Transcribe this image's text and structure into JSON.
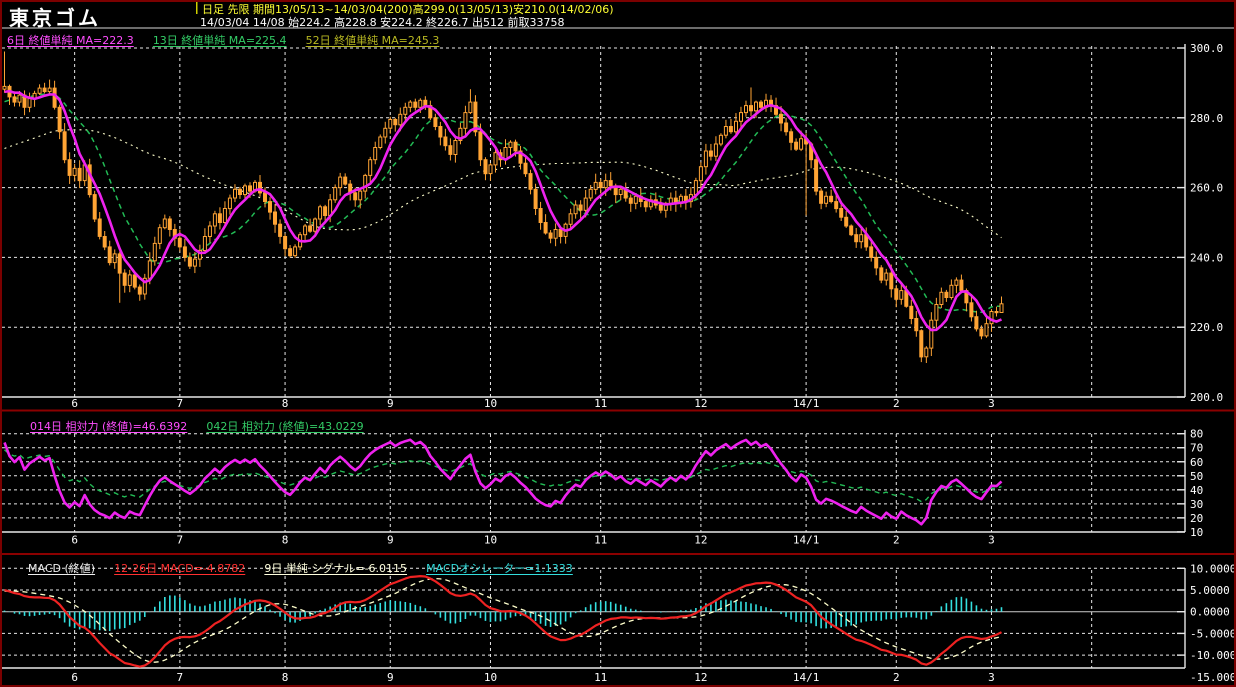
{
  "header": {
    "title": "東京ゴム",
    "info_line1": "日足 先限 期間13/05/13~14/03/04(200)高299.0(13/05/13)安210.0(14/02/06)",
    "info_line2": "14/03/04 14/08 始224.2 高228.8 安224.2 終226.7 出512 前取33758"
  },
  "main_legend": {
    "ma6": "6日 終値単純 MA=222.3",
    "ma13": "13日 終値単純 MA=225.4",
    "ma52": "52日 終値単純 MA=245.3"
  },
  "rsi_legend": {
    "rsi14": "014日 相対力 (終値)=46.6392",
    "rsi42": "042日 相対力 (終値)=43.0229"
  },
  "macd_legend": {
    "title": "MACD (終値)",
    "macd": "12-26日 MACD=-4.8782",
    "signal": "9日 単純 シグナル=-6.0115",
    "osc": "MACDオシレーター=1.1333"
  },
  "colors": {
    "background": "#000000",
    "frame": "#7b0000",
    "grid": "#e8e8e8",
    "candle": "#ffa435",
    "ma6": "#ee22ee",
    "ma13": "#22bb55",
    "ma52": "#ffffcc",
    "rsi14": "#ee22ee",
    "rsi42": "#22bb55",
    "macd_line": "#ee2222",
    "signal_line": "#ffffcc",
    "histogram": "#33e0e0",
    "axis_text": "#ffffff",
    "header_accent": "#cfcf00"
  },
  "chart_data": [
    {
      "type": "candlestick",
      "title": "東京ゴム 日足 先限 13/05/13-14/03/04 (200本)",
      "ylim": [
        200,
        300
      ],
      "yticks": [
        "300.0",
        "280.0",
        "260.0",
        "240.0",
        "220.0",
        "200.0"
      ],
      "ytick_values": [
        300,
        280,
        260,
        240,
        220,
        200
      ],
      "grid": true,
      "legend_position": "top-left",
      "period_high": {
        "value": 299.0,
        "date": "13/05/13"
      },
      "period_low": {
        "value": 210.0,
        "date": "14/02/06"
      },
      "last_bar": {
        "date": "14/03/04",
        "open": 224.2,
        "high": 228.8,
        "low": 224.2,
        "close": 226.7,
        "volume": 512,
        "open_interest": 33758
      },
      "month_ticks": [
        {
          "label": "6",
          "day": 14
        },
        {
          "label": "7",
          "day": 35
        },
        {
          "label": "8",
          "day": 56
        },
        {
          "label": "9",
          "day": 77
        },
        {
          "label": "10",
          "day": 97
        },
        {
          "label": "11",
          "day": 119
        },
        {
          "label": "12",
          "day": 139
        },
        {
          "label": "14/1",
          "day": 160
        },
        {
          "label": "2",
          "day": 178
        },
        {
          "label": "3",
          "day": 197
        },
        {
          "label": "",
          "day": 217
        }
      ],
      "ma_series": [
        {
          "name": "6日 終値単純",
          "period": 6,
          "last_value": 222.3
        },
        {
          "name": "13日 終値単純",
          "period": 13,
          "last_value": 225.4
        },
        {
          "name": "52日 終値単純",
          "period": 52,
          "last_value": 245.3
        }
      ],
      "closes": [
        289,
        286,
        284.5,
        286.5,
        283,
        285.5,
        287,
        288.5,
        287.5,
        288.5,
        283,
        276,
        268,
        263.5,
        265.5,
        262,
        266.5,
        258,
        251,
        246,
        243,
        238.5,
        241,
        235.5,
        232,
        235,
        231.5,
        229.5,
        234,
        239,
        244,
        248.5,
        251,
        248,
        245.5,
        243,
        240,
        237.5,
        239.5,
        242,
        246,
        249,
        252.5,
        250,
        254,
        257,
        259.5,
        258,
        260.5,
        259,
        261.5,
        258.5,
        256,
        253,
        249.5,
        246,
        242.5,
        240.5,
        243,
        246.5,
        249,
        247.5,
        251,
        254.5,
        252,
        256.5,
        260,
        263,
        261,
        258.5,
        256.5,
        259,
        263.5,
        268,
        271.5,
        274.5,
        277,
        279.5,
        278,
        281,
        283,
        284.5,
        283,
        285,
        283.5,
        280,
        277.5,
        274.5,
        272,
        269.5,
        273.5,
        277,
        281.5,
        284.5,
        276,
        268,
        264,
        266.5,
        270,
        268,
        271.5,
        273,
        270.5,
        267,
        264,
        259.5,
        254,
        250,
        247,
        245.5,
        248,
        246,
        249.5,
        252.5,
        255,
        253.5,
        257,
        259.5,
        261.5,
        260,
        262,
        260.5,
        258,
        259.5,
        257,
        255.5,
        257.5,
        256,
        254.5,
        256.5,
        255,
        253.5,
        255.5,
        257,
        255.5,
        257.5,
        256,
        258,
        262,
        266,
        270.5,
        269,
        272.5,
        275,
        277.5,
        276,
        279,
        281.5,
        283.5,
        282,
        284.5,
        283,
        285,
        283.5,
        281,
        278.5,
        276,
        273,
        271,
        274,
        272.5,
        268,
        259,
        255.5,
        257.5,
        256,
        254,
        251.5,
        249,
        246.5,
        244.5,
        246.5,
        243,
        240,
        237,
        233.5,
        235.5,
        231,
        228,
        230.5,
        226,
        222.5,
        219,
        211.5,
        214,
        222,
        226.5,
        230,
        228.5,
        232,
        233.5,
        230.5,
        227,
        223,
        219.5,
        217.5,
        221,
        224.5,
        224.2,
        226.7
      ],
      "wick_overrides": {
        "0": {
          "high": 299.0
        },
        "23": {
          "low": 227.0
        },
        "93": {
          "high": 288.2
        },
        "149": {
          "high": 288.7
        },
        "160": {
          "low": 252.0
        },
        "183": {
          "low": 210.0
        },
        "199": {
          "high": 228.8,
          "low": 224.2
        }
      }
    },
    {
      "type": "line",
      "title": "相対力 (RSI)",
      "ylim": [
        10,
        80
      ],
      "yticks": [
        "80",
        "70",
        "60",
        "50",
        "40",
        "30",
        "20",
        "10"
      ],
      "ytick_values": [
        80,
        70,
        60,
        50,
        40,
        30,
        20,
        10
      ],
      "grid": true,
      "derived_from": "closes",
      "series": [
        {
          "name": "014日 相対力 (終値)",
          "period": 14,
          "last_value": 46.6392,
          "style": "solid"
        },
        {
          "name": "042日 相対力 (終値)",
          "period": 42,
          "last_value": 43.0229,
          "style": "dashed"
        }
      ]
    },
    {
      "type": "macd",
      "title": "MACD (終値)",
      "ylim": [
        -15,
        10
      ],
      "yticks": [
        "10.0000",
        "5.0000",
        "0.0000",
        "-5.0000",
        "-10.0000",
        "-15.0000"
      ],
      "ytick_values": [
        10,
        5,
        0,
        -5,
        -10,
        -15
      ],
      "grid": true,
      "derived_from": "closes",
      "params": {
        "fast": 12,
        "slow": 26,
        "signal_period": 9,
        "signal_type": "単純"
      },
      "last_values": {
        "macd": -4.8782,
        "signal": -6.0115,
        "oscillator": 1.1333
      }
    }
  ]
}
